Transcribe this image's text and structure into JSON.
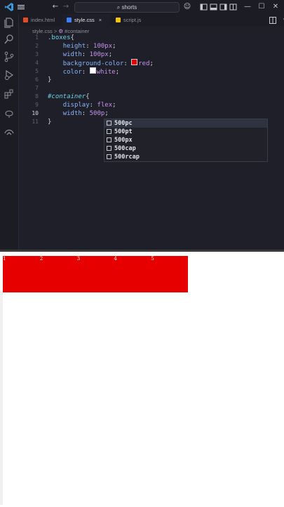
{
  "titlebar": {
    "search_text": "shorts",
    "icons": [
      "vscode-logo-icon",
      "menu-icon",
      "back-arrow-icon",
      "forward-arrow-icon",
      "search-icon",
      "copilot-icon",
      "toggle-sidebar-icon",
      "toggle-panel-icon",
      "toggle-secondary-icon",
      "layout-icon",
      "minimize-icon",
      "maximize-icon",
      "close-icon"
    ]
  },
  "activity_bar": {
    "items": [
      "explorer-icon",
      "search-icon",
      "source-control-icon",
      "run-debug-icon",
      "extensions-icon",
      "testing-icon",
      "remote-icon"
    ]
  },
  "tabs": [
    {
      "label": "index.html",
      "badge_color": "#e34c26",
      "active": false
    },
    {
      "label": "style.css",
      "badge_color": "#3b82f6",
      "active": true,
      "close": "×"
    },
    {
      "label": "script.js",
      "badge_color": "#f1c40f",
      "active": false
    }
  ],
  "breadcrumb": {
    "file": "style.css",
    "separator": ">",
    "symbol": "#container"
  },
  "editor": {
    "current_line": 10,
    "line_numbers": [
      "1",
      "2",
      "3",
      "4",
      "5",
      "6",
      "7",
      "8",
      "9",
      "10",
      "11"
    ],
    "lines": {
      "l1_selector": ".boxes",
      "l1_brace": "{",
      "l2_prop": "height",
      "l2_value": "100px",
      "l3_prop": "width",
      "l3_value": "100px",
      "l4_prop": "background-color",
      "l4_value": "red",
      "l5_prop": "color",
      "l5_value": "white",
      "l6_brace": "}",
      "l8_selector": "#container",
      "l8_brace": "{",
      "l9_prop": "display",
      "l9_value": "flex",
      "l10_prop": "width",
      "l10_value": "500p",
      "l11_brace": "}"
    },
    "colors": {
      "red_swatch": "#e60000",
      "white_swatch": "#ffffff"
    }
  },
  "autocomplete": {
    "items": [
      "500pc",
      "500pt",
      "500px",
      "500cap",
      "500rcap"
    ],
    "selected_index": 0
  },
  "preview": {
    "boxes": [
      "1",
      "2",
      "3",
      "4",
      "5"
    ],
    "box_color": "#e60000"
  }
}
